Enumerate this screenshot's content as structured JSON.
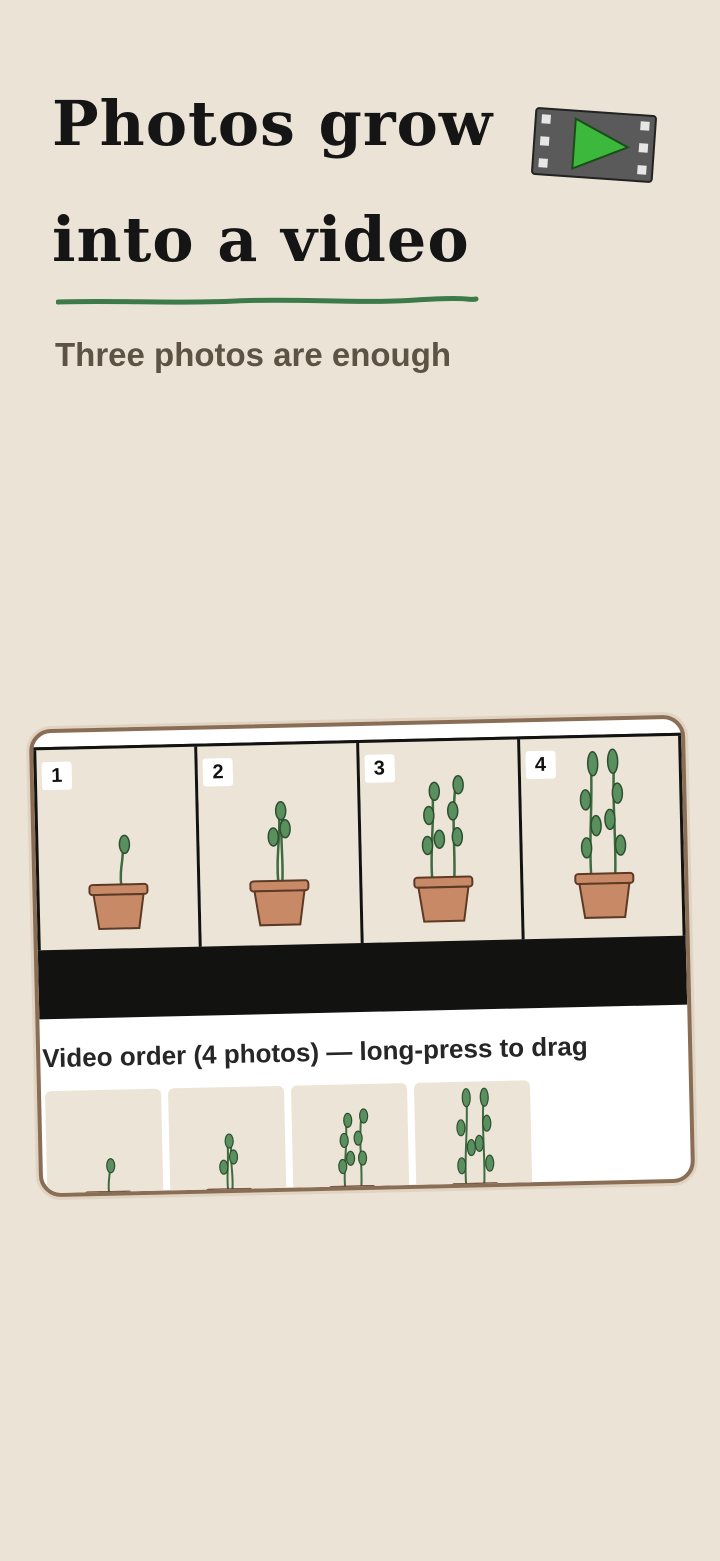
{
  "hero": {
    "title_line1": "Photos grow",
    "title_line2": "into a video",
    "subtitle": "Three photos are enough",
    "accent_color": "#3c7a4a"
  },
  "illustration": {
    "icon": "film-play-icon"
  },
  "preview": {
    "frames": [
      {
        "number": "1",
        "growth_stage": 1
      },
      {
        "number": "2",
        "growth_stage": 2
      },
      {
        "number": "3",
        "growth_stage": 3
      },
      {
        "number": "4",
        "growth_stage": 4
      }
    ],
    "order_label": "Video order (4 photos) — long-press to drag",
    "thumbnails": [
      {
        "growth_stage": 1
      },
      {
        "growth_stage": 2
      },
      {
        "growth_stage": 3
      },
      {
        "growth_stage": 4
      }
    ]
  }
}
